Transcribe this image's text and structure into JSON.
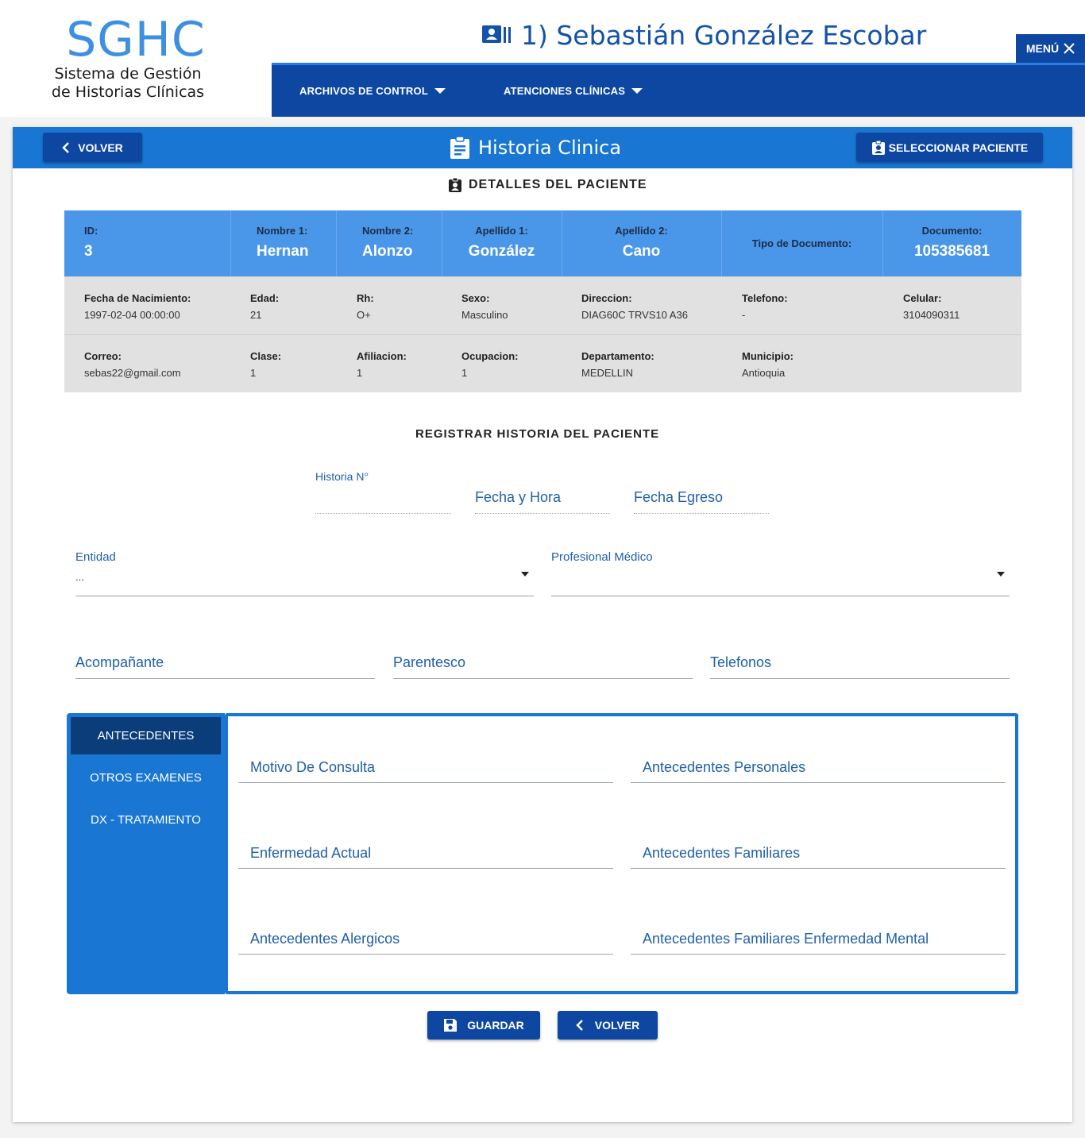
{
  "header": {
    "logo_big": "SGHC",
    "logo_line1": "Sistema de Gestión",
    "logo_line2": "de Historias Clínicas",
    "patient_title": "1) Sebastián González Escobar",
    "menu_label": "MENÚ",
    "nav": [
      {
        "label": "ARCHIVOS DE CONTROL"
      },
      {
        "label": "ATENCIONES CLÍNICAS"
      }
    ]
  },
  "card": {
    "back_label": "VOLVER",
    "title": "Historia Clinica",
    "select_patient_label": "SELECCIONAR PACIENTE",
    "details_title": "DETALLES DEL PACIENTE"
  },
  "patient": {
    "row1": [
      {
        "label": "ID:",
        "value": "3"
      },
      {
        "label": "Nombre 1:",
        "value": "Hernan"
      },
      {
        "label": "Nombre 2:",
        "value": "Alonzo"
      },
      {
        "label": "Apellido 1:",
        "value": "González"
      },
      {
        "label": "Apellido 2:",
        "value": "Cano"
      },
      {
        "label": "Tipo de Documento:",
        "value": ""
      },
      {
        "label": "Documento:",
        "value": "105385681"
      }
    ],
    "row2": [
      {
        "label": "Fecha de Nacimiento:",
        "value": "1997-02-04 00:00:00"
      },
      {
        "label": "Edad:",
        "value": "21"
      },
      {
        "label": "Rh:",
        "value": "O+"
      },
      {
        "label": "Sexo:",
        "value": "Masculino"
      },
      {
        "label": "Direccion:",
        "value": "DIAG60C TRVS10 A36"
      },
      {
        "label": "Telefono:",
        "value": "-"
      },
      {
        "label": "Celular:",
        "value": "3104090311"
      }
    ],
    "row3": [
      {
        "label": "Correo:",
        "value": "sebas22@gmail.com"
      },
      {
        "label": "Clase:",
        "value": "1"
      },
      {
        "label": "Afiliacion:",
        "value": "1"
      },
      {
        "label": "Ocupacion:",
        "value": "1"
      },
      {
        "label": "Departamento:",
        "value": "MEDELLIN"
      },
      {
        "label": "Municipio:",
        "value": "Antioquia"
      }
    ]
  },
  "form": {
    "title": "REGISTRAR HISTORIA DEL PACIENTE",
    "historia_label": "Historia N°",
    "fecha_hora_label": "Fecha y Hora",
    "fecha_egreso_label": "Fecha Egreso",
    "entidad_label": "Entidad",
    "entidad_value": "...",
    "profesional_label": "Profesional Médico",
    "acompanante_label": "Acompañante",
    "parentesco_label": "Parentesco",
    "telefonos_label": "Telefonos"
  },
  "tabs": [
    {
      "label": "ANTECEDENTES"
    },
    {
      "label": "OTROS EXAMENES"
    },
    {
      "label": "DX - TRATAMIENTO"
    }
  ],
  "tab_fields": {
    "motivo": "Motivo De Consulta",
    "ant_personales": "Antecedentes Personales",
    "enfermedad": "Enfermedad Actual",
    "ant_familiares": "Antecedentes Familiares",
    "ant_alergicos": "Antecedentes Alergicos",
    "ant_fam_mental": "Antecedentes Familiares Enfermedad Mental"
  },
  "actions": {
    "save_label": "GUARDAR",
    "back_label": "VOLVER"
  }
}
